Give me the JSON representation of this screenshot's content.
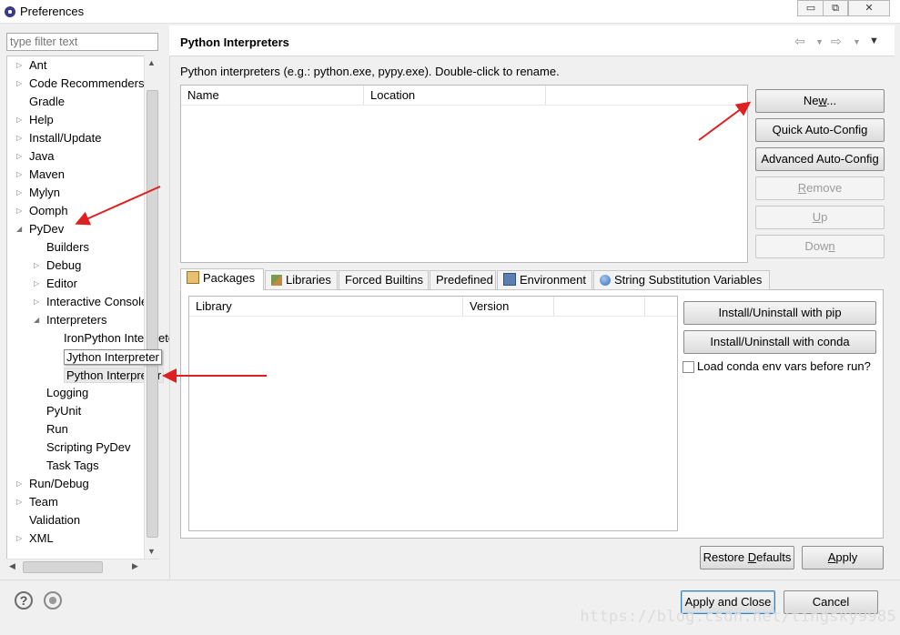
{
  "window": {
    "title": "Preferences",
    "controls": [
      "minimize",
      "restore",
      "close"
    ],
    "control_glyphs": [
      "▭",
      "⧉",
      "✕"
    ]
  },
  "filter": {
    "placeholder": "type filter text"
  },
  "tree": {
    "items": [
      {
        "label": "Ant",
        "expand": "collapsed"
      },
      {
        "label": "Code Recommenders",
        "expand": "collapsed"
      },
      {
        "label": "Gradle",
        "expand": "none"
      },
      {
        "label": "Help",
        "expand": "collapsed"
      },
      {
        "label": "Install/Update",
        "expand": "collapsed"
      },
      {
        "label": "Java",
        "expand": "collapsed"
      },
      {
        "label": "Maven",
        "expand": "collapsed"
      },
      {
        "label": "Mylyn",
        "expand": "collapsed"
      },
      {
        "label": "Oomph",
        "expand": "collapsed"
      },
      {
        "label": "PyDev",
        "expand": "expanded"
      },
      {
        "label": "Builders",
        "expand": "none"
      },
      {
        "label": "Debug",
        "expand": "collapsed"
      },
      {
        "label": "Editor",
        "expand": "collapsed"
      },
      {
        "label": "Interactive Console",
        "expand": "collapsed"
      },
      {
        "label": "Interpreters",
        "expand": "expanded"
      },
      {
        "label": "IronPython Interpreter",
        "expand": "none"
      },
      {
        "label": "Jython Interpreter",
        "expand": "none"
      },
      {
        "label": "Python Interpreter",
        "expand": "none"
      },
      {
        "label": "Logging",
        "expand": "none"
      },
      {
        "label": "PyUnit",
        "expand": "none"
      },
      {
        "label": "Run",
        "expand": "none"
      },
      {
        "label": "Scripting PyDev",
        "expand": "none"
      },
      {
        "label": "Task Tags",
        "expand": "none"
      },
      {
        "label": "Run/Debug",
        "expand": "collapsed"
      },
      {
        "label": "Team",
        "expand": "collapsed"
      },
      {
        "label": "Validation",
        "expand": "none"
      },
      {
        "label": "XML",
        "expand": "collapsed"
      }
    ],
    "selected": "Python Interpreter",
    "tooltip": "Jython Interpreter"
  },
  "panel": {
    "title": "Python Interpreters",
    "description": "Python interpreters (e.g.: python.exe, pypy.exe).   Double-click to rename.",
    "interpreters_table": {
      "columns": [
        "Name",
        "Location"
      ],
      "rows": []
    }
  },
  "buttons": {
    "new_pre": "Ne",
    "new_mnemonic": "w",
    "new_post": "...",
    "quick_auto_config": "Quick Auto-Config",
    "advanced_auto_config": "Advanced Auto-Config",
    "remove_mnemonic": "R",
    "remove_rest": "emove",
    "up_mnemonic": "U",
    "up_rest": "p",
    "down_pre": "Dow",
    "down_mnemonic": "n",
    "install_pip": "Install/Uninstall with pip",
    "install_conda": "Install/Uninstall with conda",
    "restore_pre": "Restore ",
    "restore_mnemonic": "D",
    "restore_post": "efaults",
    "apply_mnemonic": "A",
    "apply_rest": "pply",
    "apply_and_close": "Apply and Close",
    "cancel": "Cancel"
  },
  "tabs": [
    {
      "label": "Packages",
      "active": true
    },
    {
      "label": "Libraries",
      "active": false
    },
    {
      "label": "Forced Builtins",
      "active": false
    },
    {
      "label": "Predefined",
      "active": false
    },
    {
      "label": "Environment",
      "active": false
    },
    {
      "label": "String Substitution Variables",
      "active": false
    }
  ],
  "packages_table": {
    "columns": [
      "Library",
      "Version"
    ],
    "rows": []
  },
  "conda_option": {
    "label": "Load conda env vars before run?",
    "checked": false
  },
  "footer": {
    "help_icon": "question-mark-icon",
    "preferences_icon": "record-icon"
  },
  "watermark": "https://blog.csdn.net/tingsky9985",
  "annotations": {
    "arrow_color": "#e02020",
    "arrow_count": 3
  }
}
